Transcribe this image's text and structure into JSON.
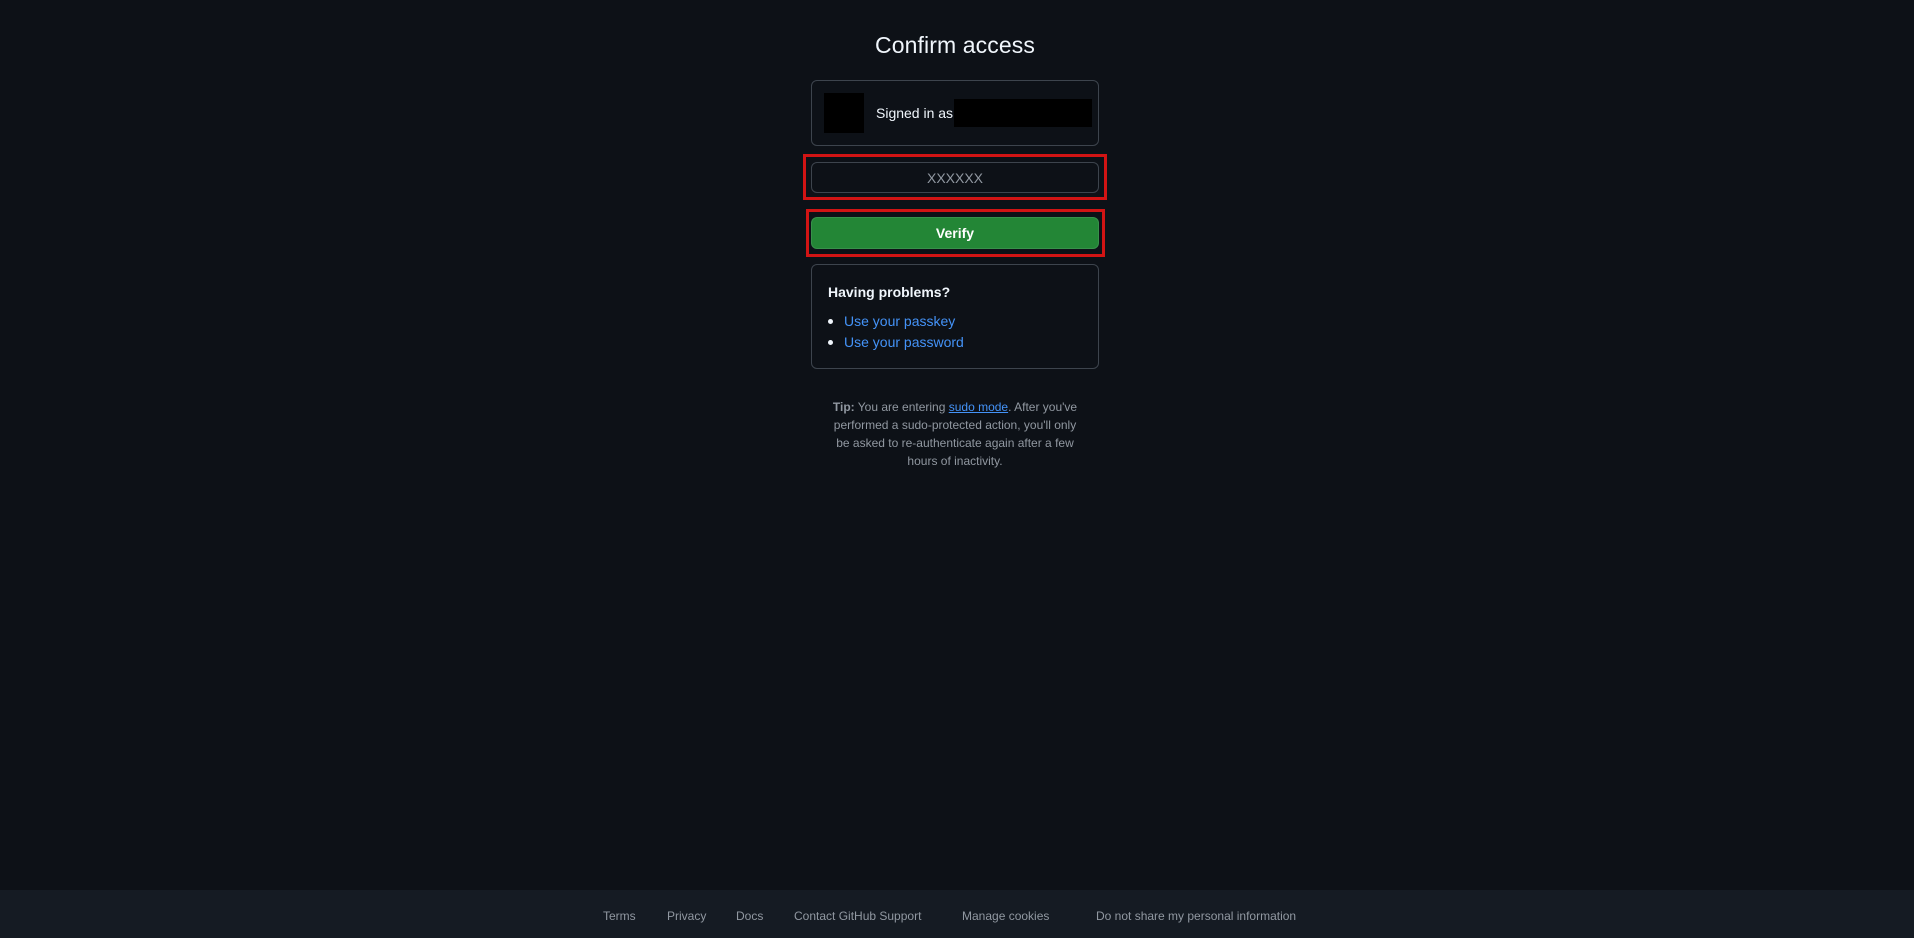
{
  "page": {
    "title": "Confirm access"
  },
  "session": {
    "signed_in_label": "Signed in as"
  },
  "otp": {
    "placeholder": "XXXXXX",
    "value": ""
  },
  "actions": {
    "verify_label": "Verify"
  },
  "problems": {
    "heading": "Having problems?",
    "links": [
      {
        "label": "Use your passkey"
      },
      {
        "label": "Use your password"
      }
    ]
  },
  "tip": {
    "prefix": "Tip:",
    "text_before": " You are entering ",
    "link": "sudo mode",
    "text_after": ". After you've performed a sudo-protected action, you'll only be asked to re-authenticate again after a few hours of inactivity."
  },
  "footer": {
    "links": [
      {
        "label": "Terms"
      },
      {
        "label": "Privacy"
      },
      {
        "label": "Docs"
      },
      {
        "label": "Contact GitHub Support"
      },
      {
        "label": "Manage cookies"
      },
      {
        "label": "Do not share my personal information"
      }
    ]
  },
  "colors": {
    "background": "#0d1117",
    "footer_bg": "#151b23",
    "accent_link": "#4493f8",
    "button_green": "#238636",
    "highlight_red": "#d21414"
  }
}
